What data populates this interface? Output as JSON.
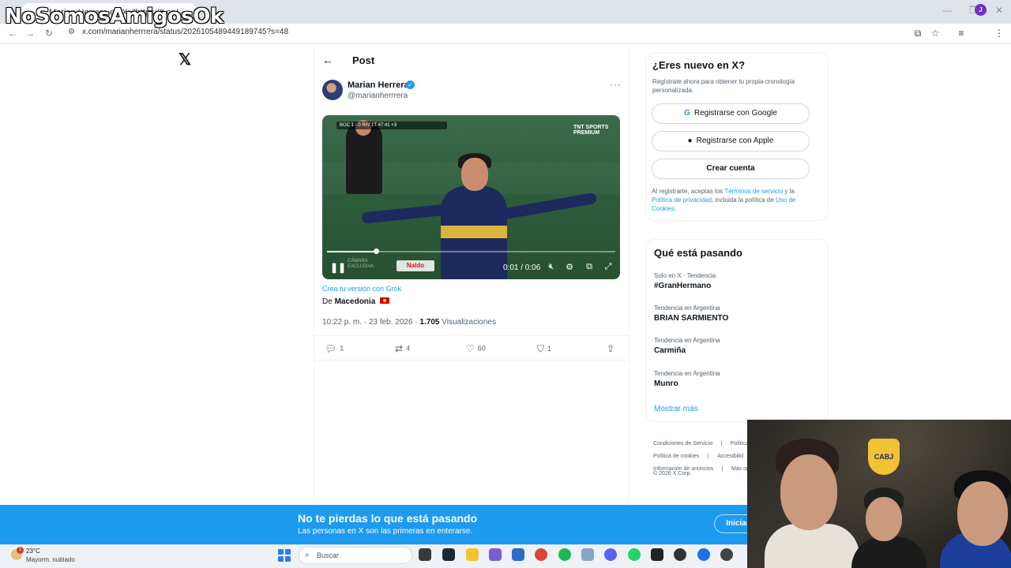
{
  "browser": {
    "tab_title": "Marian Herrera en X: \"https://t.co/...",
    "url": "x.com/marianherrrera/status/2026105489449189745?s=48",
    "window_controls": [
      "—",
      "❐",
      "✕"
    ],
    "profile_initial": "J"
  },
  "watermark": "NoSomosAmigosOk",
  "page": {
    "heading": "Post",
    "author": {
      "name": "Marian Herrera",
      "handle": "@marianherrrera"
    },
    "video": {
      "time": "0:01 / 0:06",
      "progress": 0.17,
      "scorebug": "BOC 1 - 0 RIV  1T  47:41  +3",
      "broadcaster": "TNT SPORTS PREMIUM",
      "camera_label": "CÁMARA EXCLUSIVA",
      "sponsor": "Naldo"
    },
    "grok_link": "Crea tu versión con Grok",
    "origin_prefix": "De",
    "origin_country": "Macedonia",
    "meta": {
      "time_date": "10:22 p. m. · 23 feb. 2026 ·",
      "views": "1.705",
      "views_label": "Visualizaciones"
    },
    "actions": {
      "replies": "1",
      "reposts": "4",
      "likes": "60",
      "bookmarks": "1"
    }
  },
  "sidebar": {
    "signup_title": "¿Eres nuevo en X?",
    "signup_sub": "Regístrate ahora para obtener tu propia cronología personalizada.",
    "btn_google": "Registrarse con Google",
    "btn_apple": "Registrarse con Apple",
    "btn_create": "Crear cuenta",
    "legal_prefix": "Al registrarte, aceptas los",
    "legal_terms": "Términos de servicio",
    "legal_and": "y la",
    "legal_privacy": "Política de privacidad",
    "legal_mid": ", incluida la política de",
    "legal_cookies": "Uso de Cookies",
    "legal_end": ".",
    "trends_title": "Qué está pasando",
    "trends": [
      {
        "meta": "Solo en X · Tendencia",
        "name": "#GranHermano"
      },
      {
        "meta": "Tendencia en Argentina",
        "name": "BRIAN SARMIENTO"
      },
      {
        "meta": "Tendencia en Argentina",
        "name": "Carmiña"
      },
      {
        "meta": "Tendencia en Argentina",
        "name": "Munro"
      }
    ],
    "show_more": "Mostrar más",
    "footer": {
      "row1": [
        "Condiciones de Servicio",
        "|",
        "Política d"
      ],
      "row2": [
        "Política de cookies",
        "|",
        "Accesibilid"
      ],
      "row3": [
        "Información de anuncios",
        "|",
        "Más op"
      ],
      "copyright": "© 2026 X Corp."
    }
  },
  "banner": {
    "title": "No te pierdas lo que está pasando",
    "subtitle": "Las personas en X son las primeras en enterarse.",
    "login": "Iniciar"
  },
  "taskbar": {
    "temp": "23°C",
    "weather": "Mayorm. nublado",
    "badge": "1",
    "search_placeholder": "Buscar"
  },
  "webcam": {
    "badge_text": "CABJ"
  },
  "colors": {
    "accent": "#1d9bf0",
    "text": "#0f1419",
    "muted": "#536471",
    "taskbar": "#eef1f6"
  }
}
